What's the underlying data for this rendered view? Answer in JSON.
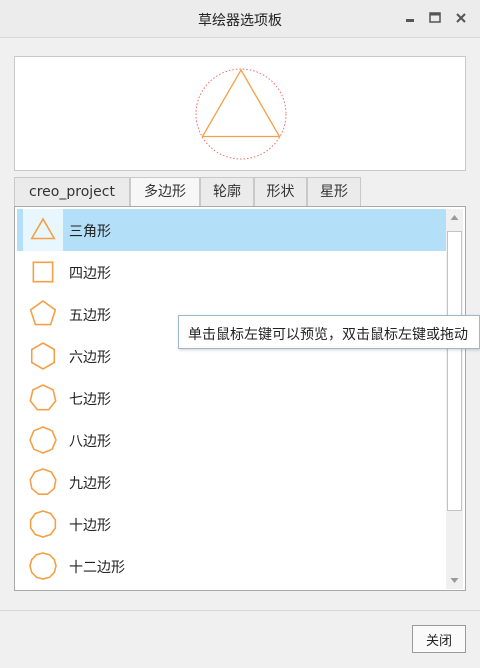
{
  "window": {
    "title": "草绘器选项板",
    "controls": [
      "minimize-icon",
      "maximize-icon",
      "close-icon"
    ]
  },
  "preview": {
    "shape": "triangle-icon",
    "stroke_color": "#f5a046",
    "guide_color": "#f06a6a"
  },
  "tabs": [
    {
      "label": "creo_project",
      "active": false
    },
    {
      "label": "多边形",
      "active": true
    },
    {
      "label": "轮廓",
      "active": false
    },
    {
      "label": "形状",
      "active": false
    },
    {
      "label": "星形",
      "active": false
    }
  ],
  "items": [
    {
      "label": "三角形",
      "icon": "triangle-icon",
      "selected": true
    },
    {
      "label": "四边形",
      "icon": "square-icon",
      "selected": false
    },
    {
      "label": "五边形",
      "icon": "pentagon-icon",
      "selected": false
    },
    {
      "label": "六边形",
      "icon": "hexagon-icon",
      "selected": false
    },
    {
      "label": "七边形",
      "icon": "heptagon-icon",
      "selected": false
    },
    {
      "label": "八边形",
      "icon": "octagon-icon",
      "selected": false
    },
    {
      "label": "九边形",
      "icon": "nonagon-icon",
      "selected": false
    },
    {
      "label": "十边形",
      "icon": "decagon-icon",
      "selected": false
    },
    {
      "label": "十二边形",
      "icon": "dodecagon-icon",
      "selected": false
    }
  ],
  "tooltip": {
    "text": "单击鼠标左键可以预览，双击鼠标左键或拖动"
  },
  "footer": {
    "close_label": "关闭"
  },
  "colors": {
    "shape_stroke": "#f5a046",
    "selection": "#b3e0f8"
  }
}
